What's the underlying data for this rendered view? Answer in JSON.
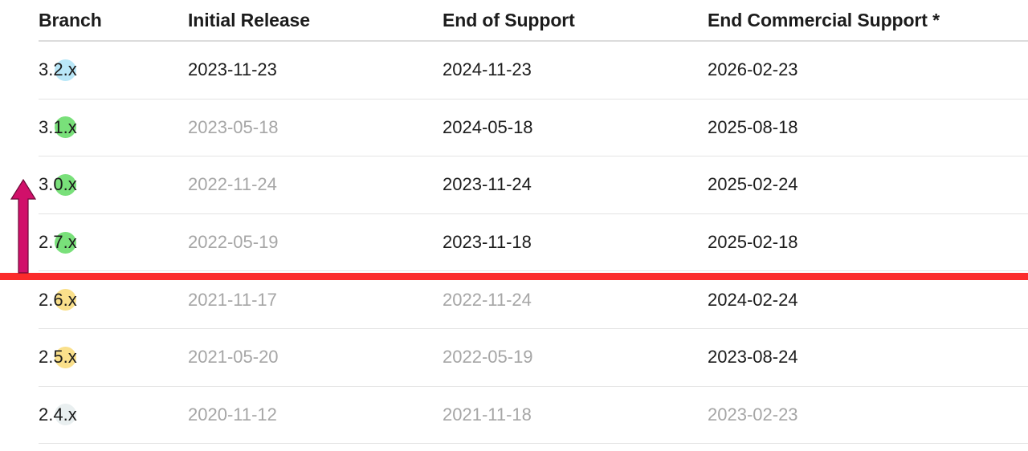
{
  "table": {
    "columns": [
      {
        "key": "status",
        "label": ""
      },
      {
        "key": "branch",
        "label": "Branch"
      },
      {
        "key": "initial_release",
        "label": "Initial Release"
      },
      {
        "key": "end_of_support",
        "label": "End of Support"
      },
      {
        "key": "end_commercial_support",
        "label": "End Commercial Support *"
      }
    ],
    "rows": [
      {
        "status_color": "#b9e7f8",
        "status_name": "status-dot-lightblue",
        "branch": "3.2.x",
        "initial_release": "2023-11-23",
        "initial_release_muted": false,
        "end_of_support": "2024-11-23",
        "end_of_support_muted": false,
        "end_commercial_support": "2026-02-23",
        "end_commercial_support_muted": false
      },
      {
        "status_color": "#79e07a",
        "status_name": "status-dot-green",
        "branch": "3.1.x",
        "initial_release": "2023-05-18",
        "initial_release_muted": true,
        "end_of_support": "2024-05-18",
        "end_of_support_muted": false,
        "end_commercial_support": "2025-08-18",
        "end_commercial_support_muted": false
      },
      {
        "status_color": "#79e07a",
        "status_name": "status-dot-green",
        "branch": "3.0.x",
        "initial_release": "2022-11-24",
        "initial_release_muted": true,
        "end_of_support": "2023-11-24",
        "end_of_support_muted": false,
        "end_commercial_support": "2025-02-24",
        "end_commercial_support_muted": false
      },
      {
        "status_color": "#79e07a",
        "status_name": "status-dot-green",
        "branch": "2.7.x",
        "initial_release": "2022-05-19",
        "initial_release_muted": true,
        "end_of_support": "2023-11-18",
        "end_of_support_muted": false,
        "end_commercial_support": "2025-02-18",
        "end_commercial_support_muted": false
      },
      {
        "status_color": "#fae08b",
        "status_name": "status-dot-yellow",
        "branch": "2.6.x",
        "initial_release": "2021-11-17",
        "initial_release_muted": true,
        "end_of_support": "2022-11-24",
        "end_of_support_muted": true,
        "end_commercial_support": "2024-02-24",
        "end_commercial_support_muted": false
      },
      {
        "status_color": "#fae08b",
        "status_name": "status-dot-yellow",
        "branch": "2.5.x",
        "initial_release": "2021-05-20",
        "initial_release_muted": true,
        "end_of_support": "2022-05-19",
        "end_of_support_muted": true,
        "end_commercial_support": "2023-08-24",
        "end_commercial_support_muted": false
      },
      {
        "status_color": "#e9eff0",
        "status_name": "status-dot-gray",
        "branch": "2.4.x",
        "initial_release": "2020-11-12",
        "initial_release_muted": true,
        "end_of_support": "2021-11-18",
        "end_of_support_muted": true,
        "end_commercial_support": "2023-02-23",
        "end_commercial_support_muted": true
      }
    ]
  },
  "annotations": {
    "cutoff_line_color": "#fb2b2b",
    "arrow_color": "#d1106a",
    "arrow_direction": "up"
  }
}
